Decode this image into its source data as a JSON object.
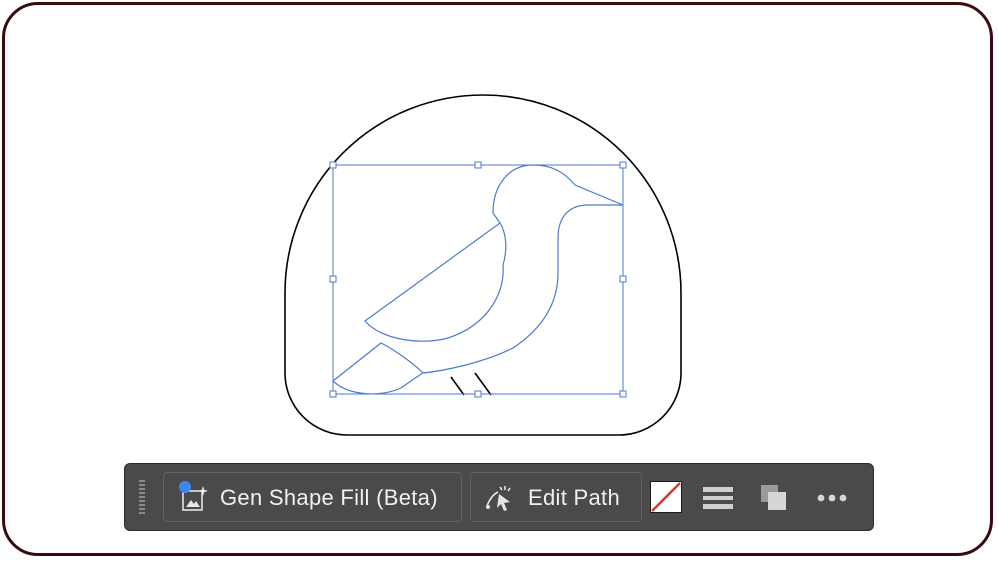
{
  "toolbar": {
    "gen_shape_fill_label": "Gen Shape Fill (Beta)",
    "edit_path_label": "Edit Path",
    "icons": {
      "grip": "drag-handle-icon",
      "gen_shape_fill": "gen-shape-fill-icon",
      "edit_path": "edit-path-icon",
      "fill_swatch": "none-fill-swatch",
      "lines": "stroke-lines-icon",
      "arrange": "arrange-icon",
      "more": "more-options-icon"
    },
    "colors": {
      "toolbar_bg": "#4a4a4a",
      "label": "#f0f0f0",
      "status_dot": "#3b8af0",
      "none_slash": "#e03030"
    }
  },
  "canvas": {
    "selection_color": "#4a7bd0",
    "outline_color": "#000000",
    "frame_color": "#3a0a0e"
  }
}
